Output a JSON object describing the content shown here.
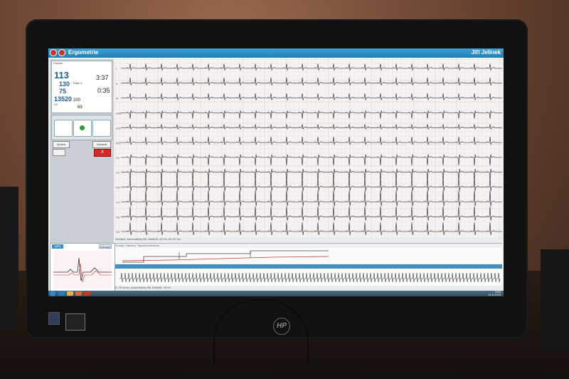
{
  "app": {
    "title": "Ergometrie",
    "user": "Jiří Jelínek"
  },
  "vitals": {
    "patient_line": "Pacient",
    "hr_value": "113",
    "bp_sys": "130",
    "bp_dia": "75",
    "dp_value": "13520",
    "dp_label": "DP",
    "time_total": "3:37",
    "time_stage": "0:35",
    "stage_label": "Fáze 3",
    "load_value": "200",
    "rpm_value": "69"
  },
  "controls": {
    "stop_label": "X",
    "button_a": "Zpráva",
    "button_b": "Zobrazit"
  },
  "ecg": {
    "footer_text": "Zesílení: Automatický filtr, Antidrift, 40 Hz, AC 50 Hz",
    "lead_labels": [
      "I",
      "II",
      "III",
      "aVR",
      "aVL",
      "aVF",
      "V1",
      "V2",
      "V3",
      "V4",
      "V5",
      "V6"
    ]
  },
  "mini_window": {
    "tab_left": "QRS",
    "tab_right": "Zobrazit"
  },
  "trend": {
    "header_text": "Trendy: Zatížení, Tepová frekvence"
  },
  "rhythm": {
    "footer_text": "II, 25 mm/s, Automatický filtr, Antidrift, 40 Hz"
  },
  "taskbar": {
    "time": "9:52",
    "date": "12.6.2015"
  },
  "monitor": {
    "brand": "HP"
  },
  "colors": {
    "titlebar": "#1f7fb3",
    "ecg_trace": "#3a3a4a",
    "accent_red": "#d62b2b",
    "screen_bg": "#eef0f2"
  }
}
